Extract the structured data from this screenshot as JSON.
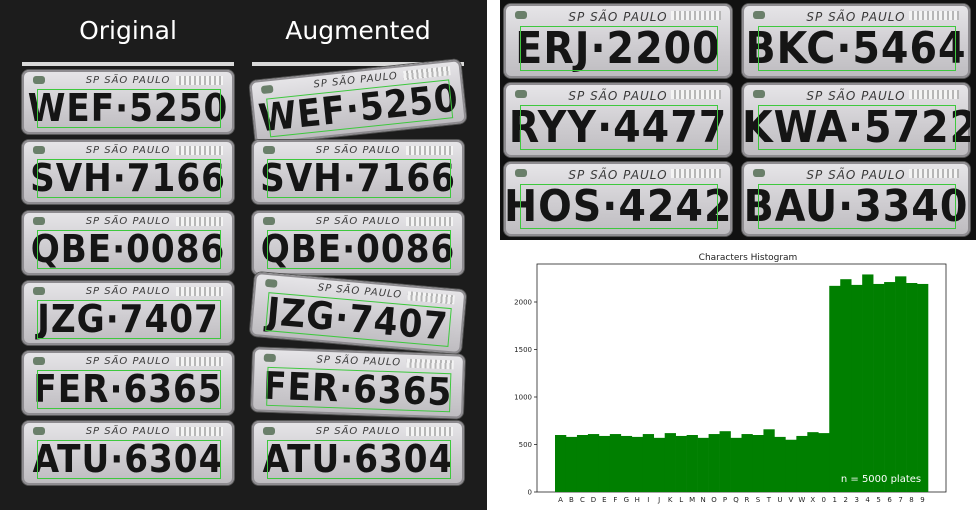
{
  "titles": {
    "original": "Original",
    "augmented": "Augmented"
  },
  "plate_header": "SP SÃO PAULO",
  "left_plates": [
    "WEF·5250",
    "SVH·7166",
    "QBE·0086",
    "JZG·7407",
    "FER·6365",
    "ATU·6304"
  ],
  "augmented_plates": [
    "WEF·5250",
    "SVH·7166",
    "QBE·0086",
    "JZG·7407",
    "FER·6365",
    "ATU·6304"
  ],
  "grid_plates": [
    "ERJ·2200",
    "BKC·5464",
    "RYY·4477",
    "KWA·5722",
    "HOS·4242",
    "BAU·3340"
  ],
  "colors": {
    "bar": "#007f00",
    "box": "#3ec83e",
    "dark_bg": "#1c1c1c"
  },
  "chart_data": {
    "type": "bar",
    "title": "Characters Histogram",
    "categories": [
      "A",
      "B",
      "C",
      "D",
      "E",
      "F",
      "G",
      "H",
      "I",
      "J",
      "K",
      "L",
      "M",
      "N",
      "O",
      "P",
      "Q",
      "R",
      "S",
      "T",
      "U",
      "V",
      "W",
      "X",
      "0",
      "1",
      "2",
      "3",
      "4",
      "5",
      "6",
      "7",
      "8",
      "9"
    ],
    "values": [
      600,
      580,
      600,
      610,
      590,
      610,
      590,
      580,
      610,
      570,
      620,
      590,
      600,
      570,
      610,
      640,
      570,
      610,
      600,
      660,
      580,
      550,
      590,
      630,
      620,
      2170,
      2240,
      2180,
      2290,
      2190,
      2210,
      2270,
      2200,
      2190
    ],
    "ylim": [
      0,
      2400
    ],
    "yticks": [
      0,
      500,
      1000,
      1500,
      2000
    ],
    "annotation": "n = 5000 plates",
    "grid": false
  }
}
